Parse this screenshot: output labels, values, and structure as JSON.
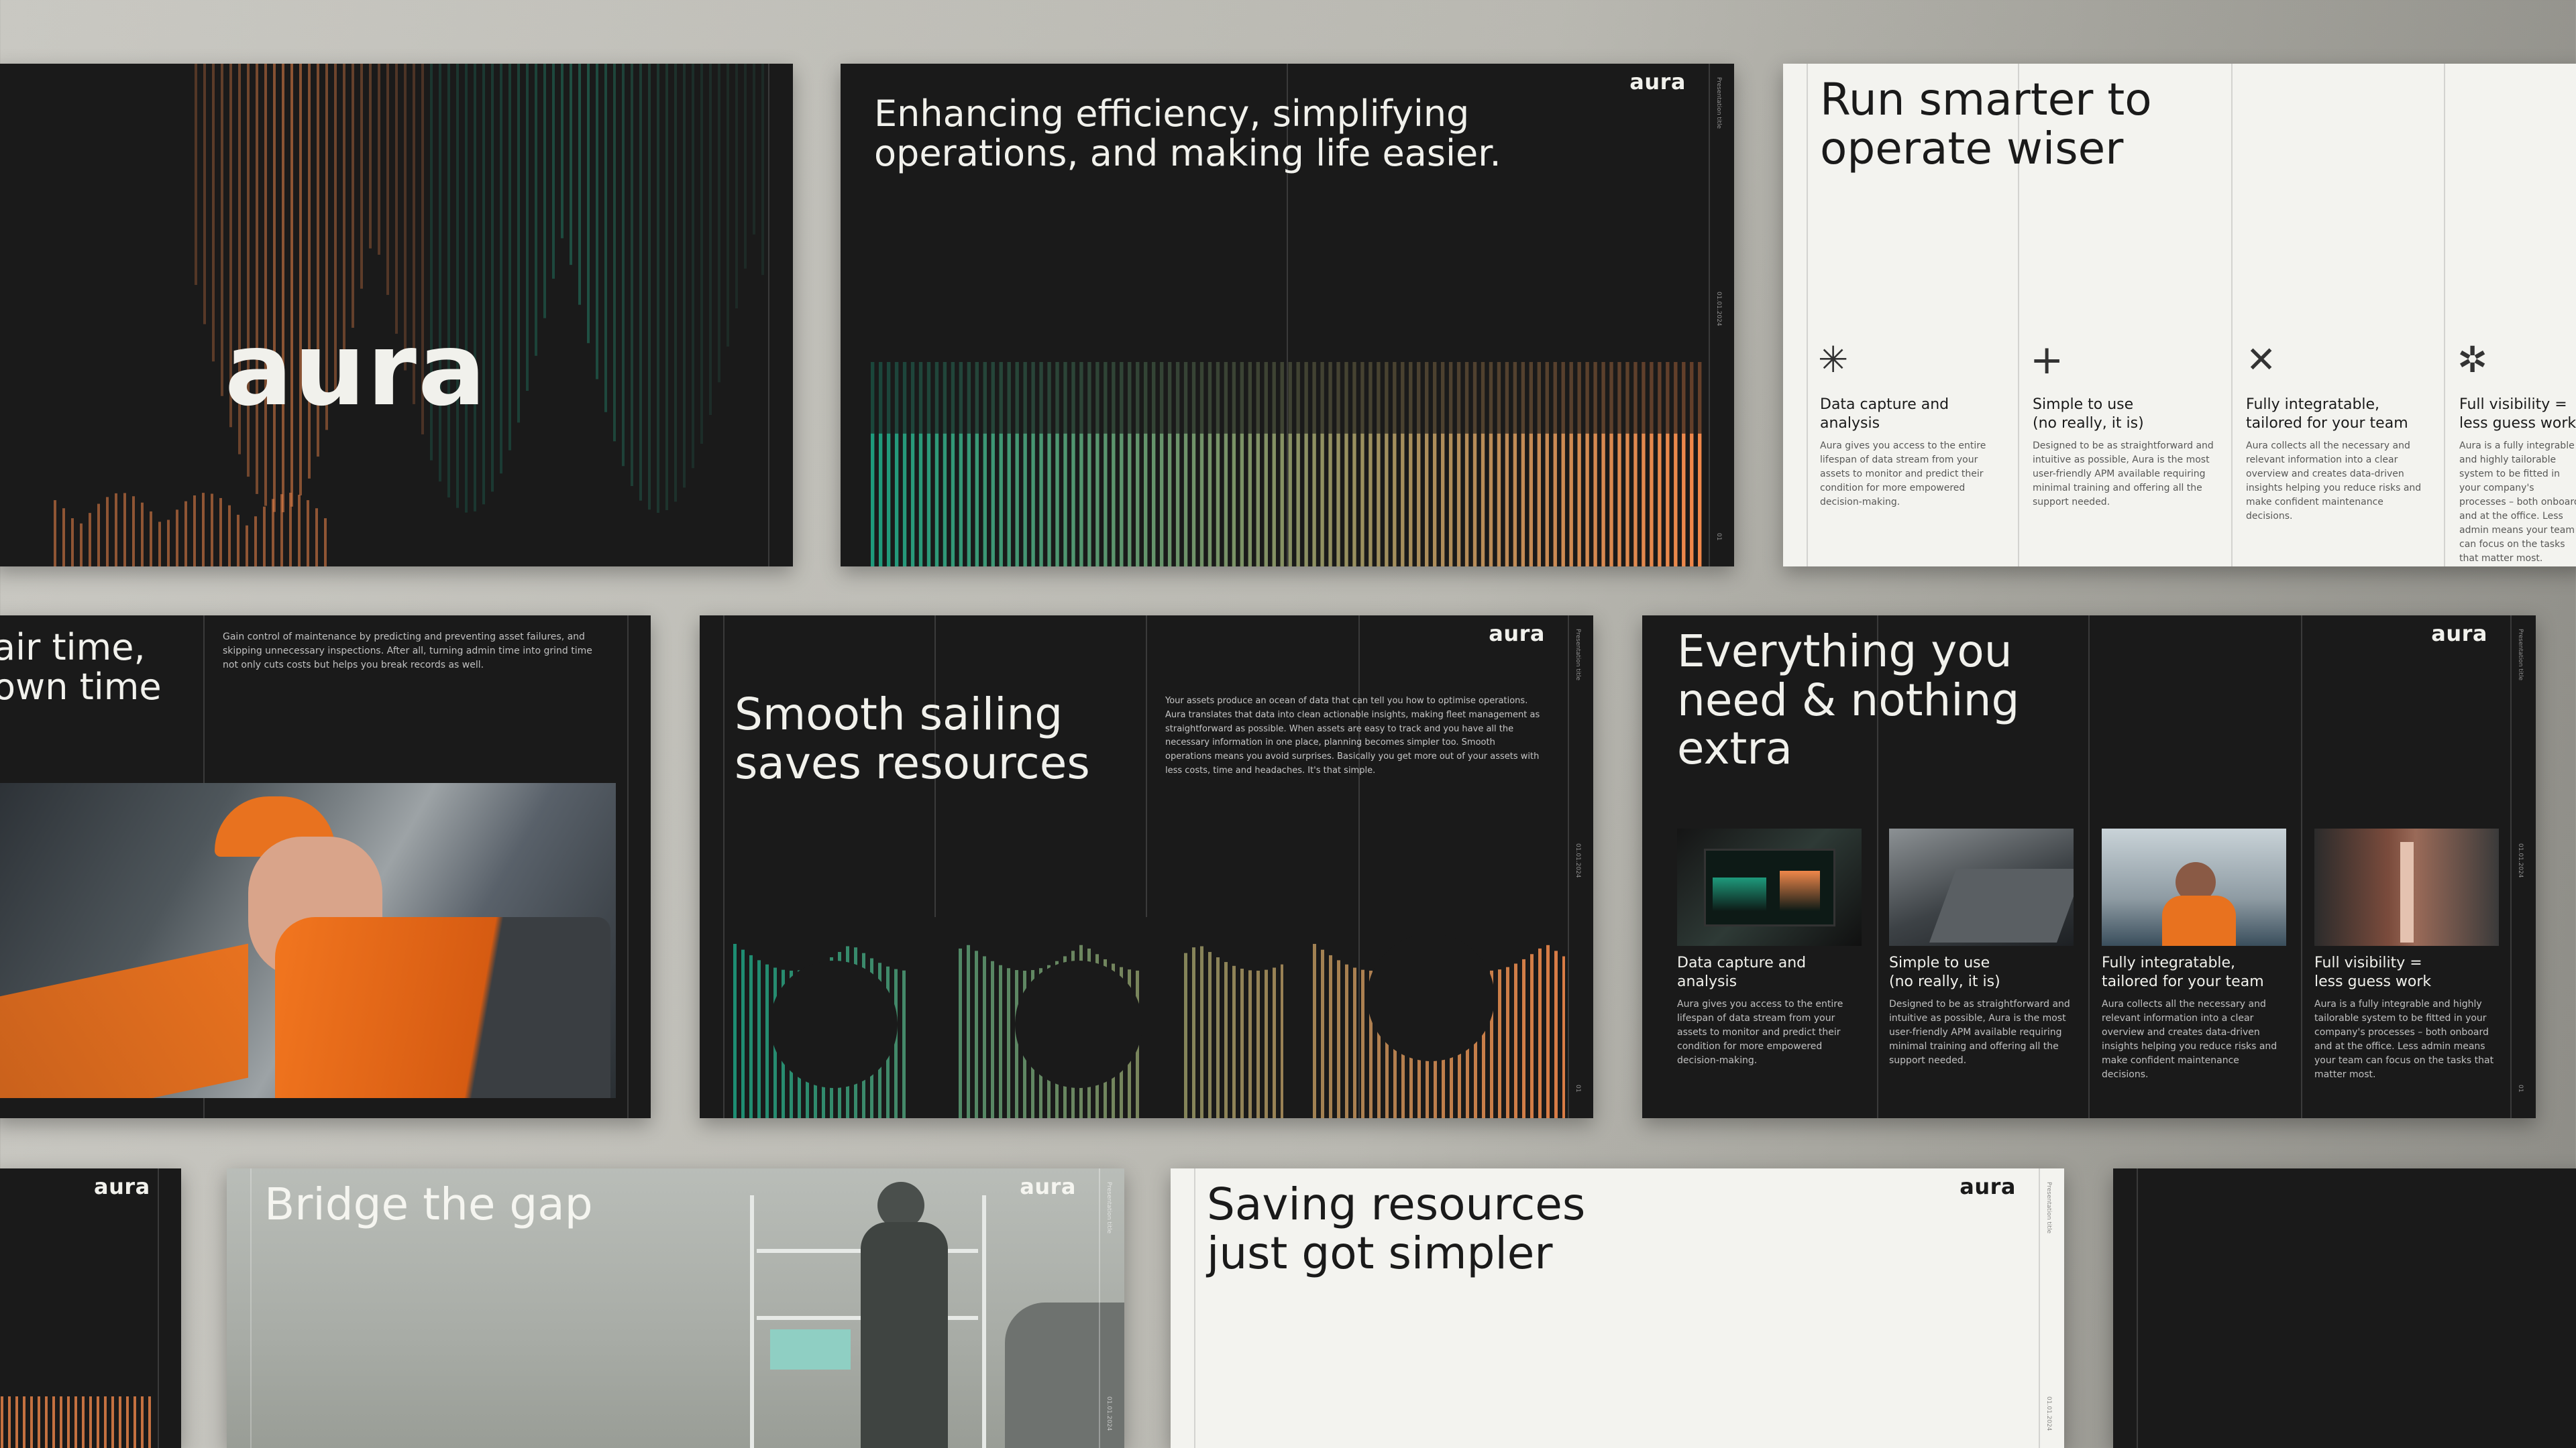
{
  "brand": {
    "logo": "aura",
    "side_title": "Presentation title",
    "side_date": "01.01.2024",
    "colors": {
      "bg_dark": "#1a1a1a",
      "bg_light": "#f3f3ef",
      "teal": "#1e9a7c",
      "orange": "#f0874a"
    }
  },
  "slides": {
    "cover": {
      "logo_big": "aura"
    },
    "efficiency": {
      "headline": "Enhancing efficiency, simplifying operations, and making life easier.",
      "page_num": "01"
    },
    "run_smarter": {
      "headline": "Run smarter to operate wiser",
      "columns": [
        {
          "icon": "asterisk-icon",
          "title": "Data capture and\nanalysis",
          "body": "Aura gives you access to the entire lifespan of data stream from your assets to monitor and predict their condition for more empowered decision-making."
        },
        {
          "icon": "plus-icon",
          "title": "Simple to use\n(no really, it is)",
          "body": "Designed to be as straightforward and intuitive as possible, Aura is the most user-friendly APM available requiring minimal training and offering all the support needed."
        },
        {
          "icon": "x-icon",
          "title": "Fully integratable,\ntailored for your team",
          "body": "Aura collects all the necessary and relevant information into a clear overview and creates data-driven insights helping you reduce risks and make confident maintenance decisions."
        },
        {
          "icon": "star-icon",
          "title": "Full visibility =\nless guess work",
          "body": "Aura is a fully integrable and highly tailorable system to be fitted in your company's processes – both onboard and at the office. Less admin means your team can focus on the tasks that matter most."
        }
      ]
    },
    "fair_time": {
      "headline": "air time,\nown time",
      "body": "Gain control of maintenance by predicting and preventing asset failures, and skipping unnecessary inspections. After all, turning admin time into grind time not only cuts costs but helps you break records as well."
    },
    "smooth_sailing": {
      "headline": "Smooth sailing saves resources",
      "body": "Your assets produce an ocean of data that can tell you how to optimise operations. Aura translates that data into clean actionable insights, making fleet management as straightforward as possible. When assets are easy to track and you have all the necessary information in one place, planning becomes simpler too. Smooth operations means you avoid surprises. Basically you get more out of your assets with less costs, time and headaches. It's that simple.",
      "page_num": "01"
    },
    "everything": {
      "headline": "Everything you need & nothing extra",
      "columns": [
        {
          "title": "Data capture and\nanalysis",
          "body": "Aura gives you access to the entire lifespan of data stream from your assets to monitor and predict their condition for more empowered decision-making."
        },
        {
          "title": "Simple to use\n(no really, it is)",
          "body": "Designed to be as straightforward and intuitive as possible, Aura is the most user-friendly APM available requiring minimal training and offering all the support needed."
        },
        {
          "title": "Fully integratable,\ntailored for your team",
          "body": "Aura collects all the necessary and relevant information into a clear overview and creates data-driven insights helping you reduce risks and make confident maintenance decisions."
        },
        {
          "title": "Full visibility =\nless guess work",
          "body": "Aura is a fully integrable and highly tailorable system to be fitted in your company's processes – both onboard and at the office. Less admin means your team can focus on the tasks that matter most."
        }
      ],
      "page_num": "01"
    },
    "bridge": {
      "headline": "Bridge the gap"
    },
    "saving": {
      "headline": "Saving resources just got simpler"
    }
  }
}
